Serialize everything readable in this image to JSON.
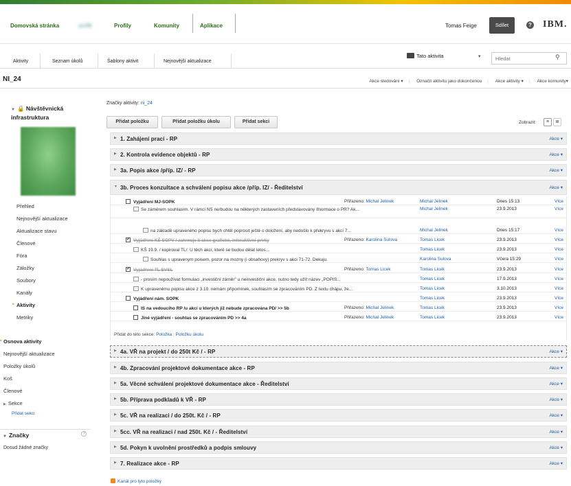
{
  "topnav": {
    "items": [
      "Domovská stránka",
      "scVK",
      "Profily",
      "Komunity",
      "Aplikace"
    ],
    "user_name": "Tomas Feige",
    "share_label": "Sdílet",
    "help": "?",
    "logo": "IBM."
  },
  "subnav": {
    "tabs": [
      "Aktivity",
      "Seznam úkolů",
      "Šablony aktivit",
      "Nejnovější aktualizace"
    ],
    "scope": "Tato aktivita",
    "search_placeholder": "Hledat"
  },
  "page": {
    "title": "NI_24",
    "actions": [
      "Akce sledování ▾",
      "Označit aktivitu jako dokončenou",
      "Akce aktivity ▾",
      "Akce komunity▾"
    ]
  },
  "sidebar": {
    "activity_name": "Návštěvnická infrastruktura",
    "items": [
      "Přehled",
      "Nejnovější aktualizace",
      "Aktualizace stavu",
      "Členové",
      "Fóra",
      "Záložky",
      "Soubory",
      "Kanály",
      "Aktivity",
      "Metriky"
    ],
    "outline_items": [
      "Osnova aktivity",
      "Nejnovější aktualizace",
      "Položky úkolů",
      "Koš",
      "Členové",
      "Sekce"
    ],
    "add_section": "Přidat sekci",
    "tags_title": "Značky",
    "tags_empty": "Dosud žádné značky"
  },
  "main": {
    "tags_label": "Značky aktivity:",
    "tags_value": "ni_24",
    "buttons": [
      "Přidat položku",
      "Přidat položku úkolu",
      "Přidat sekci"
    ],
    "view_label": "Zobrazit:",
    "section_action": "Akce ▾",
    "sections_top": [
      "1. Zahájení prací - RP",
      "2. Kontrola evidence objektů - RP",
      "3a. Popis akce /příp. IZ/ - RP",
      "3b. Proces konzultace a schválení popisu akce /příp. IZ/ - Ředitelství"
    ],
    "rows": [
      {
        "text": "Vyjádření MJ-SOPK",
        "assigned_label": "Přiřazeno:",
        "assigned": "Michal Jelinek",
        "author": "Michal Jelinek",
        "date": "Dnes 15:13",
        "more": "Více"
      },
      {
        "text": "Se záměrem souhlasím. V rámci NS ne/budou na některých zastaveních představovány ifnormace o PR? Ak...",
        "author": "Michal Jelinek",
        "date": "23.9.2013",
        "more": "Více"
      },
      {
        "text": "na základě upraveného popisu bych chtěl poprosit ještě o doložení, aby nedošlo k překryvu s akcí 7...",
        "author": "Michal Jelinek",
        "date": "Dnes 15:17",
        "more": "Více"
      },
      {
        "text": "Vyjádření KŠ SOPV / zahrnuje li akce grafické, interaktivní prvky",
        "assigned_label": "Přiřazeno:",
        "assigned": "Karolina Sulova",
        "author": "Tomas Licek",
        "date": "23.9.2013",
        "more": "Více"
      },
      {
        "text": "KŠ 19.9. / kopiroval TL/: U těch akcí, které se budou dělat letos...",
        "author": "Tomas Licek",
        "date": "23.9.2013",
        "more": "Více"
      },
      {
        "text": "Souhlas s upravenym poisem, pozor na mozny (i obsahovy) prekryv s akci 71-72. Dekuju.",
        "author": "Karolina Sulova",
        "date": "Včera 15:29",
        "more": "Více"
      },
      {
        "text": "Vyjádření TL SVSL",
        "assigned_label": "Přiřazeno:",
        "assigned": "Tomas Licek",
        "author": "Tomas Licek",
        "date": "23.9.2013",
        "more": "Více"
      },
      {
        "text": "- prosím nepoužívat formulaci „investiční záměr\" u neinvestiční akce, nutno tedy užít název „POPIS...",
        "author": "Tomas Licek",
        "date": "17.9.2013",
        "more": "Více"
      },
      {
        "text": "K upravenému popisu akce z 3.10. nemám připomínek, souhlasím se zpracováním PD. Z textu chápu, že...",
        "author": "Tomas Licek",
        "date": "3.10.2013",
        "more": "Více"
      },
      {
        "text": "Vyjádření nám. SOPK",
        "author": "Tomas Licek",
        "date": "23.9.2013",
        "more": "Více"
      },
      {
        "text": "IS na vedoucího RP /u akcí u kterých již nebude zpracována PD/ >> 5b",
        "assigned_label": "Přiřazeno:",
        "assigned": "Michal Jelinek",
        "author": "Tomas Licek",
        "date": "23.9.2013",
        "more": "Více"
      },
      {
        "text": "Jiné vyjádření - souhlas se zpracováním PD >> 4a",
        "assigned_label": "Přiřazeno:",
        "assigned": "Michal Jelinek",
        "author": "Tomas Licek",
        "date": "23.9.2013",
        "more": "Více"
      }
    ],
    "add_to_section_label": "Přidat do této sekce:",
    "add_item": "Položka",
    "add_task": "Položku úkolu",
    "sections_bottom": [
      "4a. VŘ na projekt / do 250t Kč / - RP",
      "4b. Zpracování projektové dokumentace akce - RP",
      "5a. Věcné schválení projektové dokumentace akce - Ředitelství",
      "5b. Příprava podkladů k VŘ - RP",
      "5c. VŘ na realizaci / do 250t. Kč / - RP",
      "5cc. VŘ na realizaci / nad 250t. Kč / - Ředitelství",
      "5d. Pokyn k uvolnění prostředků a podpis smlouvy",
      "7. Realizace akce - RP"
    ],
    "feed_label": "Kanál pro tyto položky"
  }
}
